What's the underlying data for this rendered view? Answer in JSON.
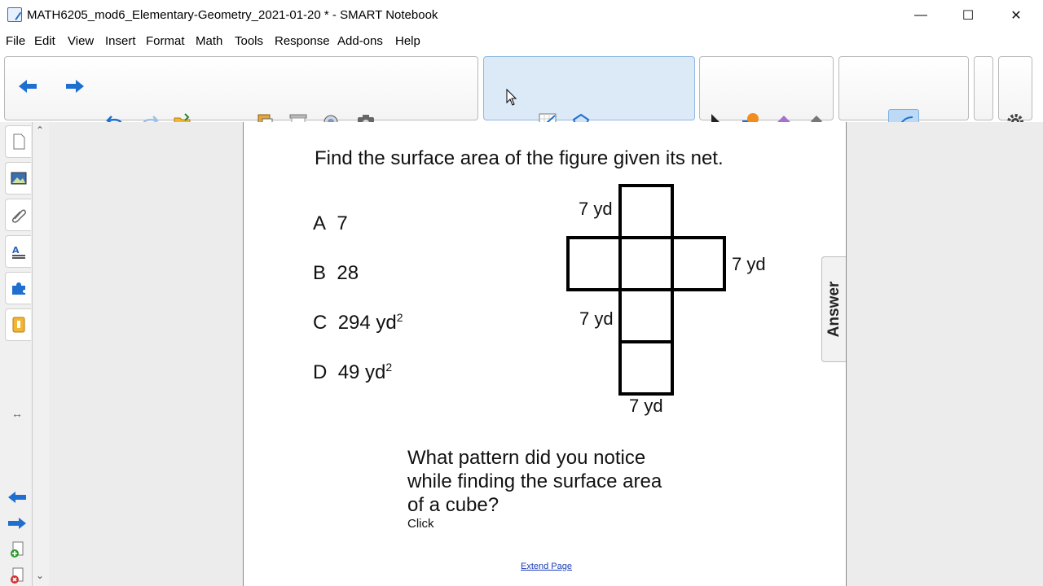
{
  "window": {
    "title": "MATH6205_mod6_Elementary-Geometry_2021-01-20 * - SMART Notebook",
    "minimize_glyph": "—",
    "maximize_glyph": "☐",
    "close_glyph": "✕"
  },
  "menu": {
    "items": [
      {
        "label": "File",
        "accel": "F"
      },
      {
        "label": "Edit",
        "accel": "E"
      },
      {
        "label": "View",
        "accel": "V"
      },
      {
        "label": "Insert",
        "accel": "I"
      },
      {
        "label": "Format",
        "accel": "o"
      },
      {
        "label": "Math",
        "accel": "M"
      },
      {
        "label": "Tools",
        "accel": "T"
      },
      {
        "label": "Response",
        "accel": "R"
      },
      {
        "label": "Add-ons",
        "accel": "A"
      },
      {
        "label": "Help",
        "accel": "H"
      }
    ]
  },
  "toolbar": {
    "icons": [
      "back-arrow-icon",
      "forward-arrow-icon",
      "undo-icon",
      "redo-icon",
      "open-folder-icon",
      "add-page-icon",
      "delete-page-icon",
      "save-icon",
      "screen-share-icon",
      "paste-icon",
      "delete-icon",
      "screen-shade-icon",
      "table-icon",
      "document-camera-icon",
      "fit-page-icon",
      "clear-ink-icon",
      "screen-capture-icon",
      "dual-page-icon",
      "insert-math-icon",
      "graph-icon",
      "shape-recognition-icon",
      "spreadsheet-icon",
      "sigma-icon",
      "lesson-activity-icon",
      "add-ons-icon",
      "select-icon",
      "shapes-icon",
      "eraser-icon",
      "fill-icon",
      "pens-icon",
      "text-icon",
      "line-icon",
      "eraser-tool-icon",
      "pen-icon",
      "stroke-style-icon",
      "settings-icon",
      "move-toolbar-icon"
    ]
  },
  "sidebar": {
    "tabs": [
      "page-sorter-icon",
      "gallery-icon",
      "attachments-icon",
      "properties-icon",
      "add-ons-tab-icon",
      "lesson-activity-tab-icon"
    ],
    "resize_glyph": "↔"
  },
  "page": {
    "question": "Find the surface area of the figure given its net.",
    "choices": [
      {
        "letter": "A",
        "value": "7",
        "sup": ""
      },
      {
        "letter": "B",
        "value": "28",
        "sup": ""
      },
      {
        "letter": "C",
        "value": "294 yd",
        "sup": "2"
      },
      {
        "letter": "D",
        "value": "49 yd",
        "sup": "2"
      }
    ],
    "dimensions": [
      "7 yd",
      "7 yd",
      "7 yd",
      "7 yd"
    ],
    "pattern_lines": [
      "What pattern did you notice",
      "while finding the surface area",
      "of a cube?"
    ],
    "click_text": "Click",
    "extend_link": "Extend Page",
    "answer_tab": "Answer"
  },
  "colors": {
    "accent_blue": "#1e6fd0",
    "toolbar_active": "#dceaf8",
    "link": "#1a3db8"
  }
}
